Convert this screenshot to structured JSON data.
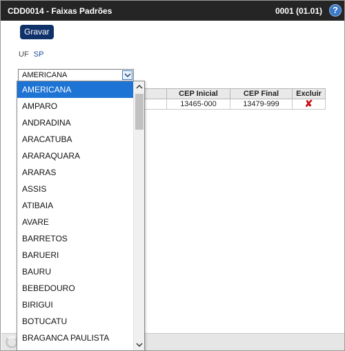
{
  "window": {
    "title": "CDD0014 - Faixas Padrões",
    "code": "0001 (01.01)",
    "help_glyph": "?"
  },
  "toolbar": {
    "save_label": "Gravar"
  },
  "uf": {
    "label": "UF",
    "value": "SP"
  },
  "city_select": {
    "value": "AMERICANA"
  },
  "table": {
    "headers": [
      "",
      "CEP Inicial",
      "CEP Final",
      "Excluir"
    ],
    "rows": [
      {
        "blank": "",
        "cep_inicial": "13465-000",
        "cep_final": "13479-999"
      }
    ]
  },
  "dropdown": {
    "selected_index": 0,
    "options": [
      "AMERICANA",
      "AMPARO",
      "ANDRADINA",
      "ARACATUBA",
      "ARARAQUARA",
      "ARARAS",
      "ASSIS",
      "ATIBAIA",
      "AVARE",
      "BARRETOS",
      "BARUERI",
      "BAURU",
      "BEBEDOURO",
      "BIRIGUI",
      "BOTUCATU",
      "BRAGANCA PAULISTA"
    ]
  },
  "colors": {
    "titlebar": "#252525",
    "button": "#10326b",
    "selected_option": "#1e74d4",
    "delete": "#c8141b"
  }
}
